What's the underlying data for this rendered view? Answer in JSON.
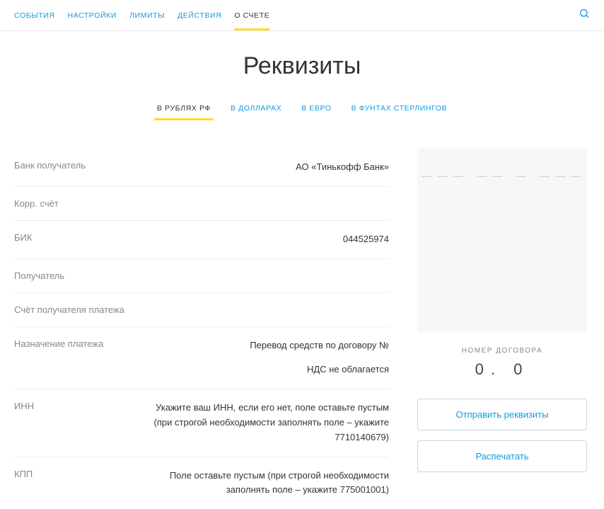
{
  "topNav": {
    "tabs": [
      {
        "label": "СОБЫТИЯ"
      },
      {
        "label": "НАСТРОЙКИ"
      },
      {
        "label": "ЛИМИТЫ"
      },
      {
        "label": "ДЕЙСТВИЯ"
      },
      {
        "label": "О СЧЕТЕ"
      }
    ]
  },
  "pageTitle": "Реквизиты",
  "currencyTabs": [
    {
      "label": "В РУБЛЯХ РФ"
    },
    {
      "label": "В ДОЛЛАРАХ"
    },
    {
      "label": "В ЕВРО"
    },
    {
      "label": "В ФУНТАХ СТЕРЛИНГОВ"
    }
  ],
  "details": {
    "bankRecipient": {
      "label": "Банк получатель",
      "value": "АО «Тинькофф Банк»"
    },
    "corrAccount": {
      "label": "Корр. счёт",
      "value": ""
    },
    "bik": {
      "label": "БИК",
      "value": "044525974"
    },
    "recipient": {
      "label": "Получатель",
      "value": ""
    },
    "recipientAccount": {
      "label": "Счёт получателя платежа",
      "value": ""
    },
    "paymentPurpose": {
      "label": "Назначение платежа",
      "value1": "Перевод средств по договору №",
      "value2": "НДС не облагается"
    },
    "inn": {
      "label": "ИНН",
      "value": "Укажите ваш ИНН, если его нет, поле оставьте пустым (при строгой необходимости заполнять поле – укажите 7710140679)"
    },
    "kpp": {
      "label": "КПП",
      "value": "Поле оставьте пустым (при строгой необходимости заполнять поле – укажите 775001001)"
    }
  },
  "sidebar": {
    "contractLabel": "НОМЕР ДОГОВОРА",
    "contractNumber": "0.      0",
    "sendButton": "Отправить реквизиты",
    "printButton": "Распечатать"
  }
}
